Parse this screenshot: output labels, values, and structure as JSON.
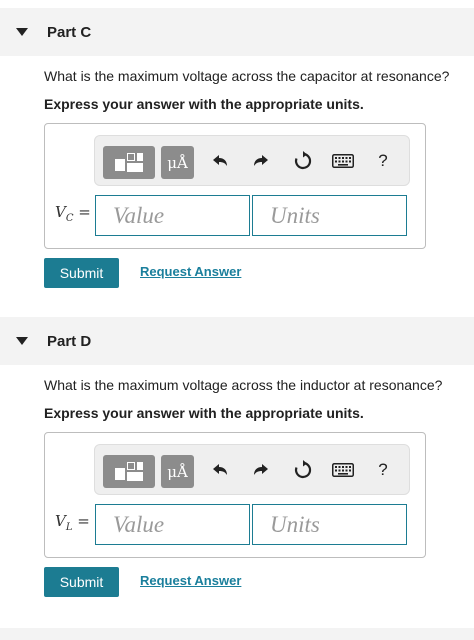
{
  "parts": [
    {
      "title": "Part C",
      "question": "What is the maximum voltage across the capacitor at resonance?",
      "instruction": "Express your answer with the appropriate units.",
      "variable": "V",
      "variable_sub": "C",
      "equals": "=",
      "value_placeholder": "Value",
      "units_placeholder": "Units",
      "submit_label": "Submit",
      "request_label": "Request Answer"
    },
    {
      "title": "Part D",
      "question": "What is the maximum voltage across the inductor at resonance?",
      "instruction": "Express your answer with the appropriate units.",
      "variable": "V",
      "variable_sub": "L",
      "equals": "=",
      "value_placeholder": "Value",
      "units_placeholder": "Units",
      "submit_label": "Submit",
      "request_label": "Request Answer"
    }
  ],
  "toolbar": {
    "units_label": "μÅ",
    "help_label": "?",
    "icons": [
      "templates-icon",
      "units-icon",
      "undo-icon",
      "redo-icon",
      "reset-icon",
      "keyboard-icon",
      "help-icon"
    ]
  },
  "colors": {
    "accent": "#1c7c92",
    "header_bg": "#f3f3f3",
    "toolbar_button": "#8c8c8c"
  }
}
